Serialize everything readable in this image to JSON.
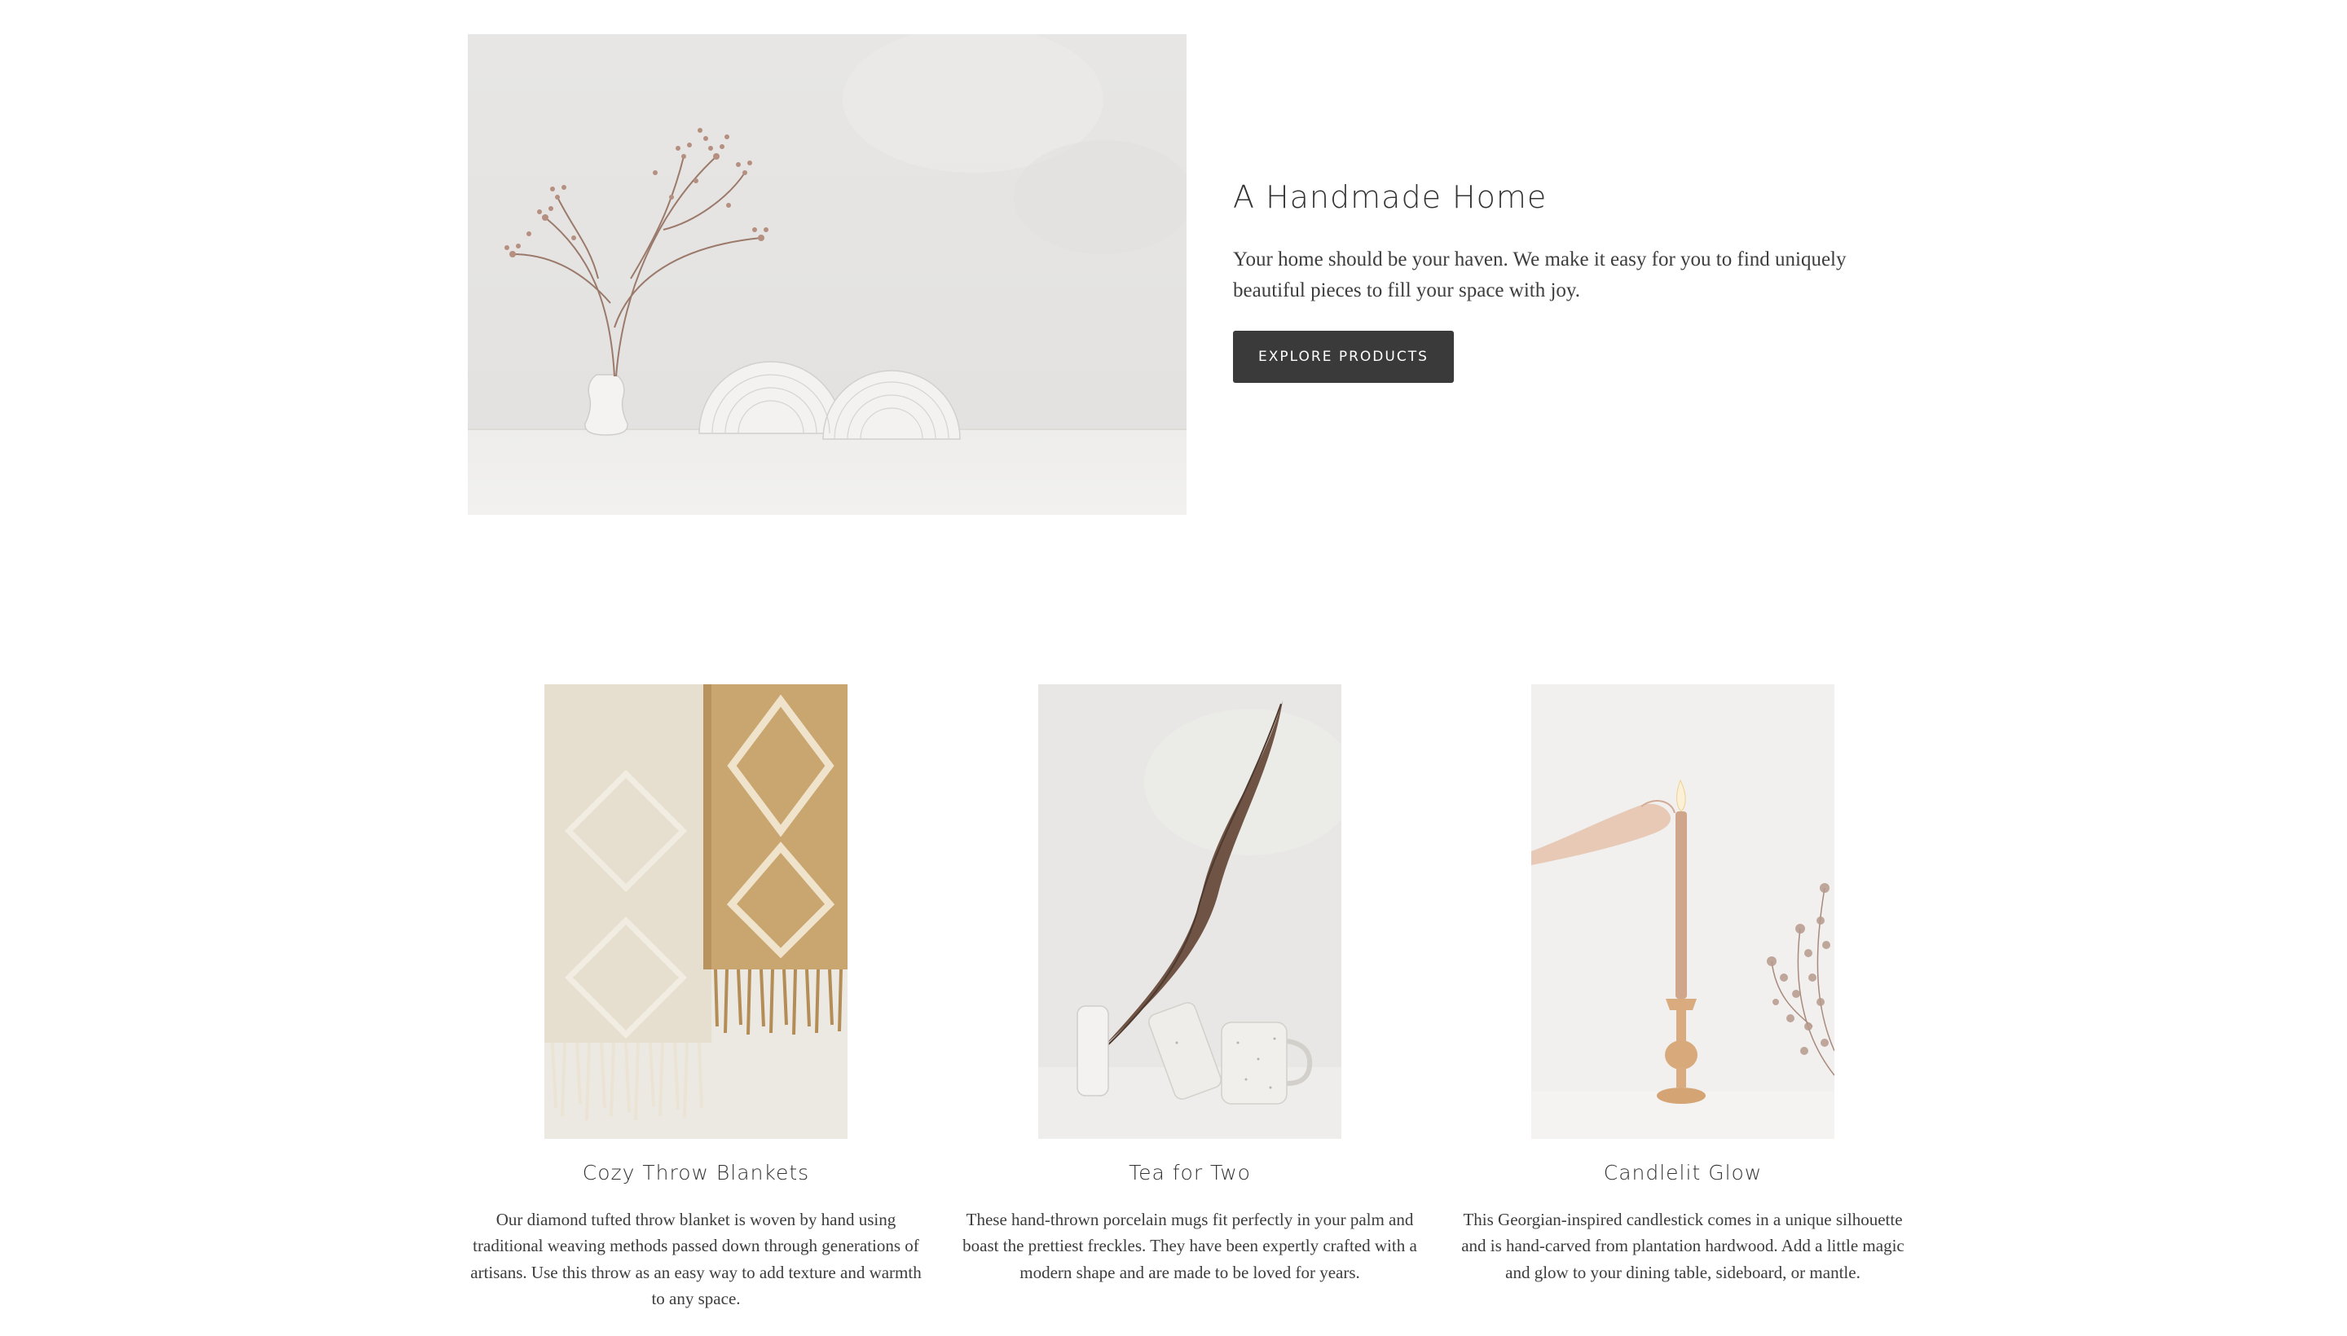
{
  "hero": {
    "title": "A Handmade Home",
    "body": "Your home should be your haven. We make it easy for you to find uniquely beautiful pieces to fill your space with joy.",
    "button_label": "EXPLORE PRODUCTS",
    "button_color": "#3a3a3a"
  },
  "columns": [
    {
      "title": "Cozy Throw Blankets",
      "body": "Our diamond tufted throw blanket is woven by hand using traditional weaving methods passed down through generations of artisans. Use this throw as an easy way to add texture and warmth to any space."
    },
    {
      "title": "Tea for Two",
      "body": "These hand-thrown porcelain mugs fit perfectly in your palm and boast the prettiest freckles. They have been expertly crafted with a modern shape and are made to be loved for years."
    },
    {
      "title": "Candlelit Glow",
      "body": "This Georgian-inspired candlestick comes in a unique silhouette and is hand-carved from plantation hardwood. Add a little magic and glow to your dining table, sideboard, or mantle."
    }
  ]
}
